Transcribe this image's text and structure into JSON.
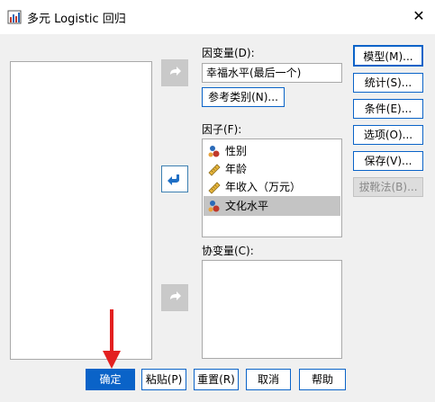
{
  "window": {
    "title": "多元 Logistic 回归",
    "close_glyph": "✕"
  },
  "dependent": {
    "label": "因变量(D):",
    "value": "幸福水平(最后一个)",
    "ref_button": "参考类别(N)..."
  },
  "factors": {
    "label": "因子(F):",
    "items": [
      {
        "label": "性别",
        "icon": "nominal-icon",
        "selected": false
      },
      {
        "label": "年龄",
        "icon": "scale-ruler-icon",
        "selected": false
      },
      {
        "label": "年收入（万元）",
        "icon": "scale-ruler-icon",
        "selected": false
      },
      {
        "label": "文化水平",
        "icon": "nominal-icon",
        "selected": true
      }
    ]
  },
  "covariates": {
    "label": "协变量(C):"
  },
  "side_buttons": {
    "model": "模型(M)...",
    "statistics": "统计(S)...",
    "criteria": "条件(E)...",
    "options": "选项(O)...",
    "save": "保存(V)...",
    "bootstrap": "拔靴法(B)..."
  },
  "bottom_buttons": {
    "ok": "确定",
    "paste": "粘贴(P)",
    "reset": "重置(R)",
    "cancel": "取消",
    "help": "帮助"
  },
  "colors": {
    "accent": "#0a63c8",
    "arrow_red": "#e32020"
  }
}
